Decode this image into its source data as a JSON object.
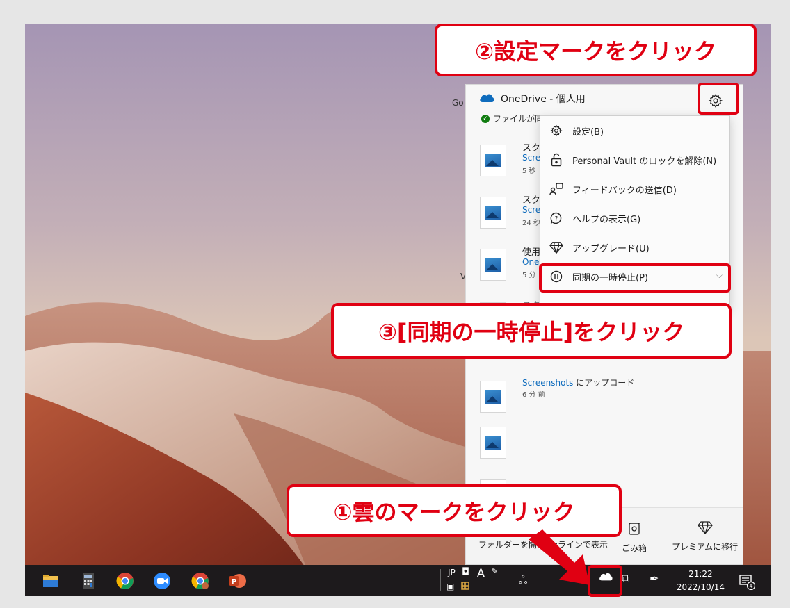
{
  "desktop": {
    "partial_left_1": "Go",
    "partial_left_2": "V"
  },
  "onedrive": {
    "title": "OneDrive",
    "subtitle": " - 個人用",
    "status": "ファイルが同",
    "status_trail": "...",
    "files": [
      {
        "name": "スク",
        "link": "Scre",
        "link_rest": "",
        "time": "5 秒"
      },
      {
        "name": "スク",
        "link": "Scre",
        "link_rest": "",
        "time": "24 秒"
      },
      {
        "name": "使用",
        "link": "One",
        "link_rest": "",
        "time": "5 分"
      },
      {
        "name": "スク",
        "link": "",
        "link_rest": "",
        "time": ""
      },
      {
        "name": "",
        "link": "Screenshots",
        "link_rest": " にアップロード",
        "time": "6 分 前"
      },
      {
        "name": "",
        "link": "",
        "link_rest": "",
        "time": ""
      },
      {
        "name": "",
        "link": "",
        "link_rest": "",
        "time": ""
      }
    ],
    "bottom": {
      "open_folder": "フォルダーを開",
      "view_online": "ンラインで表示",
      "recycle_bin": "ごみ箱",
      "premium": "プレミアムに移行"
    }
  },
  "menu": {
    "items": [
      {
        "label": "設定(B)",
        "icon": "gear-icon"
      },
      {
        "label": "Personal Vault のロックを解除(N)",
        "icon": "unlock-icon"
      },
      {
        "label": "フィードバックの送信(D)",
        "icon": "feedback-icon"
      },
      {
        "label": "ヘルプの表示(G)",
        "icon": "help-icon"
      },
      {
        "label": "アップグレード(U)",
        "icon": "diamond-icon"
      },
      {
        "label": "同期の一時停止(P)",
        "icon": "pause-icon"
      }
    ]
  },
  "taskbar": {
    "ime_jp": "JP",
    "ime_a": "A",
    "time": "21:22",
    "date": "2022/10/14",
    "notifications": "4"
  },
  "callouts": {
    "step1": "①雲のマークをクリック",
    "step2": "②設定マークをクリック",
    "step3": "③[同期の一時停止]をクリック"
  },
  "colors": {
    "accent": "#e00012",
    "onedrive_blue": "#0f6cbd",
    "taskbar": "#1d1a1c"
  }
}
